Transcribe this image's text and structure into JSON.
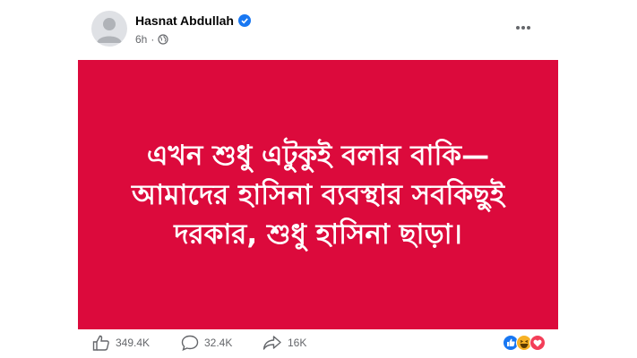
{
  "post": {
    "author": "Hasnat Abdullah",
    "time": "6h",
    "separator": "·",
    "text": "এখন শুধু এটুকুই বলার বাকি— আমাদের হাসিনা ব্যবস্থার সবকিছুই দরকার, শুধু হাসিনা ছাড়া।",
    "banner_color": "#dc0a3c"
  },
  "stats": {
    "likes": "349.4K",
    "comments": "32.4K",
    "shares": "16K"
  },
  "icons": {
    "verified": "verified-badge-icon",
    "audience": "globe-icon",
    "more": "more-options-icon",
    "like": "thumbs-up-icon",
    "comment": "comment-icon",
    "share": "share-icon",
    "reactions": [
      "like-reaction-icon",
      "haha-reaction-icon",
      "love-reaction-icon"
    ]
  }
}
